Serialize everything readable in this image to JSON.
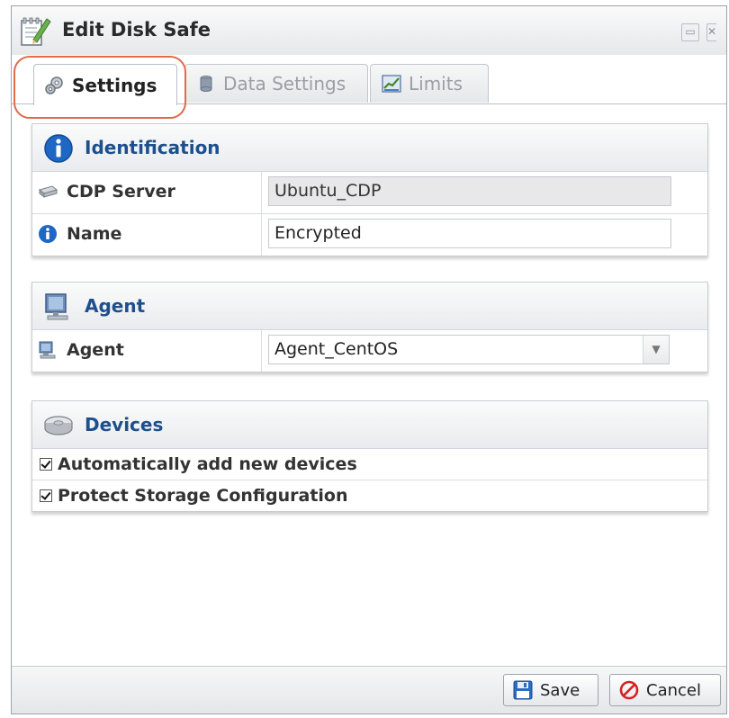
{
  "window": {
    "title": "Edit Disk Safe",
    "restore_symbol": "▭",
    "close_symbol": "✕"
  },
  "tabs": [
    {
      "label": "Settings",
      "icon": "gears-icon",
      "active": true
    },
    {
      "label": "Data Settings",
      "icon": "database-icon",
      "active": false
    },
    {
      "label": "Limits",
      "icon": "chart-icon",
      "active": false
    }
  ],
  "identification": {
    "title": "Identification",
    "cdp_server_label": "CDP Server",
    "cdp_server_value": "Ubuntu_CDP",
    "name_label": "Name",
    "name_value": "Encrypted"
  },
  "agent": {
    "title": "Agent",
    "agent_label": "Agent",
    "agent_value": "Agent_CentOS",
    "dropdown_symbol": "▼"
  },
  "devices": {
    "title": "Devices",
    "options": [
      {
        "label": "Automatically add new devices",
        "checked": true
      },
      {
        "label": "Protect Storage Configuration",
        "checked": true
      }
    ]
  },
  "footer": {
    "save_label": "Save",
    "cancel_label": "Cancel"
  },
  "colors": {
    "accent_blue": "#1d4f8c",
    "highlight_ring": "#e06a4a",
    "cancel_red": "#d52020"
  }
}
